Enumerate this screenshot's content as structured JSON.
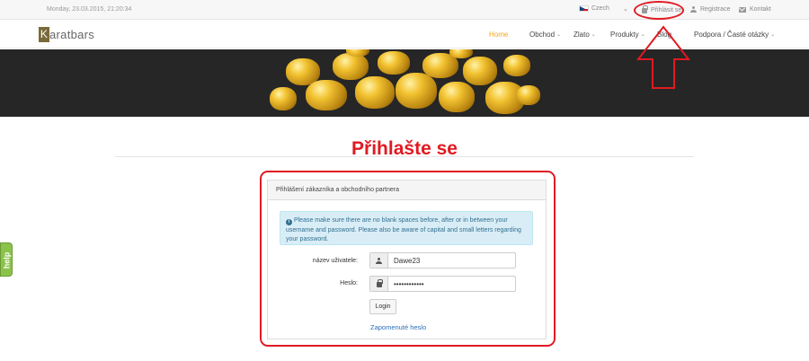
{
  "topbar": {
    "datetime": "Monday, 23.03.2015, 21:20:34",
    "language": "Czech",
    "language_caret": "⌄",
    "login": "Přihlásit se",
    "register": "Registrace",
    "contact": "Kontakt"
  },
  "nav": {
    "logo_letter": "K",
    "logo_rest": "aratbars",
    "items": [
      {
        "label": "Home",
        "active": true,
        "chevron": ""
      },
      {
        "label": "Obchod",
        "active": false,
        "chevron": "⌄"
      },
      {
        "label": "Zlato",
        "active": false,
        "chevron": "⌄"
      },
      {
        "label": "Produkty",
        "active": false,
        "chevron": "⌄"
      },
      {
        "label": "Blog",
        "active": false,
        "chevron": ""
      },
      {
        "label": "Podpora / Časté otázky",
        "active": false,
        "chevron": "⌄"
      }
    ]
  },
  "page": {
    "title": "Přihlašte se"
  },
  "panel": {
    "heading": "Přihlášení zákazníka a obchodního partnera",
    "info": "Please make sure there are no blank spaces before, after or in between your username and password. Please also be aware of capital and small letters regarding your password.",
    "username_label": "název uživatele:",
    "username_value": "Dawe23",
    "password_label": "Heslo:",
    "password_value": "••••••••••••",
    "login_button": "Login",
    "forgot_link": "Zapomenuté heslo"
  },
  "help": {
    "label": "help"
  },
  "colors": {
    "annotation": "#e01a22",
    "accent": "#f2a81e",
    "link": "#2a6ebb",
    "help_tab": "#8bc34a"
  }
}
